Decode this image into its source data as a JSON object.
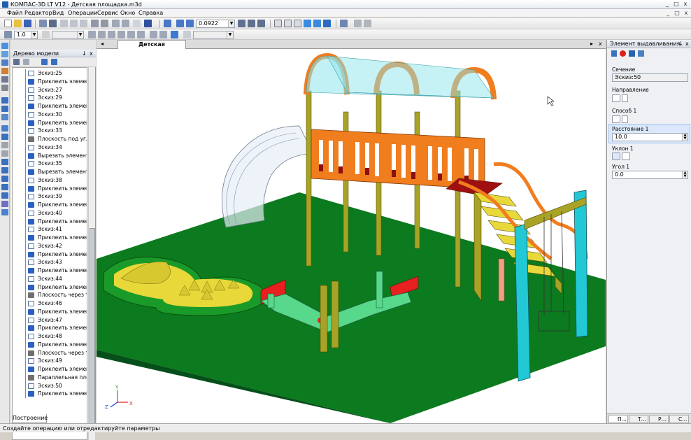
{
  "window": {
    "title": "КОМПАС-3D LT V12 - Детская площадка.m3d",
    "controls": [
      "_",
      "□",
      "x"
    ]
  },
  "menu": {
    "items": [
      "Файл",
      "Редактор",
      "Вид",
      "Операции",
      "Сервис",
      "Окно",
      "Справка"
    ],
    "doc_controls": [
      "_",
      "□",
      "x"
    ]
  },
  "toolbar": {
    "zoom_value": "0.0922",
    "line_scale": "1.0"
  },
  "document_tab": {
    "name": "Детская площадка.m3d"
  },
  "tree": {
    "title": "Дерево модели",
    "controls": [
      "↓",
      "x"
    ],
    "bottom_tab": "Построение",
    "items": [
      {
        "label": "Эскиз:25",
        "type": "sketch"
      },
      {
        "label": "Приклеить элемент в",
        "type": "extrude"
      },
      {
        "label": "Эскиз:27",
        "type": "sketch"
      },
      {
        "label": "Эскиз:29",
        "type": "sketch"
      },
      {
        "label": "Приклеить элемент в",
        "type": "extrude"
      },
      {
        "label": "Эскиз:30",
        "type": "sketch"
      },
      {
        "label": "Приклеить элемент в",
        "type": "extrude"
      },
      {
        "label": "Эскиз:33",
        "type": "sketch"
      },
      {
        "label": "Плоскость под углом",
        "type": "plane"
      },
      {
        "label": "Эскиз:34",
        "type": "sketch"
      },
      {
        "label": "Вырезать элемент вы",
        "type": "extrude"
      },
      {
        "label": "Эскиз:35",
        "type": "sketch"
      },
      {
        "label": "Вырезать элемент вы",
        "type": "extrude"
      },
      {
        "label": "Эскиз:38",
        "type": "sketch"
      },
      {
        "label": "Приклеить элемент в",
        "type": "extrude"
      },
      {
        "label": "Эскиз:39",
        "type": "sketch"
      },
      {
        "label": "Приклеить элемент в",
        "type": "extrude"
      },
      {
        "label": "Эскиз:40",
        "type": "sketch"
      },
      {
        "label": "Приклеить элемент в",
        "type": "extrude"
      },
      {
        "label": "Эскиз:41",
        "type": "sketch"
      },
      {
        "label": "Приклеить элемент в",
        "type": "extrude"
      },
      {
        "label": "Эскиз:42",
        "type": "sketch"
      },
      {
        "label": "Приклеить элемент в",
        "type": "extrude"
      },
      {
        "label": "Эскиз:43",
        "type": "sketch"
      },
      {
        "label": "Приклеить элемент в",
        "type": "extrude"
      },
      {
        "label": "Эскиз:44",
        "type": "sketch"
      },
      {
        "label": "Приклеить элемент в",
        "type": "extrude"
      },
      {
        "label": "Плоскость через три",
        "type": "plane"
      },
      {
        "label": "Эскиз:46",
        "type": "sketch"
      },
      {
        "label": "Приклеить элемент в",
        "type": "extrude"
      },
      {
        "label": "Эскиз:47",
        "type": "sketch"
      },
      {
        "label": "Приклеить элемент в",
        "type": "extrude"
      },
      {
        "label": "Эскиз:48",
        "type": "sketch"
      },
      {
        "label": "Приклеить элемент в",
        "type": "extrude"
      },
      {
        "label": "Плоскость через три",
        "type": "plane"
      },
      {
        "label": "Эскиз:49",
        "type": "sketch"
      },
      {
        "label": "Приклеить элемент в",
        "type": "extrude"
      },
      {
        "label": "Параллельная плоск",
        "type": "plane"
      },
      {
        "label": "Эскиз:50",
        "type": "sketch"
      },
      {
        "label": "Приклеить элемент",
        "type": "extrude"
      }
    ]
  },
  "properties": {
    "title": "Элемент выдавливания",
    "controls": [
      "↓",
      "x"
    ],
    "section_label": "Сечение",
    "section_value": "Эскиз:50",
    "direction_label": "Направление",
    "method_label": "Способ 1",
    "distance_label": "Расстояние 1",
    "distance_value": "10.0",
    "slope_label": "Уклон 1",
    "angle_label": "Угол 1",
    "angle_value": "0.0",
    "tabs": [
      "П...",
      "Т...",
      "Р...",
      "С..."
    ]
  },
  "axes": {
    "x": "X",
    "y": "Y",
    "z": "Z"
  },
  "status": "Создайте операцию или отредактируйте параметры",
  "colors": {
    "ground": "#0c7a1e",
    "structure_orange": "#f07d1e",
    "post_olive": "#a8a226",
    "roof_glass": "#8ee6ec",
    "swing_cyan": "#22c8d4",
    "seesaw_green": "#58d88a",
    "seesaw_red": "#e82020",
    "sand_yellow": "#e8d83a"
  }
}
